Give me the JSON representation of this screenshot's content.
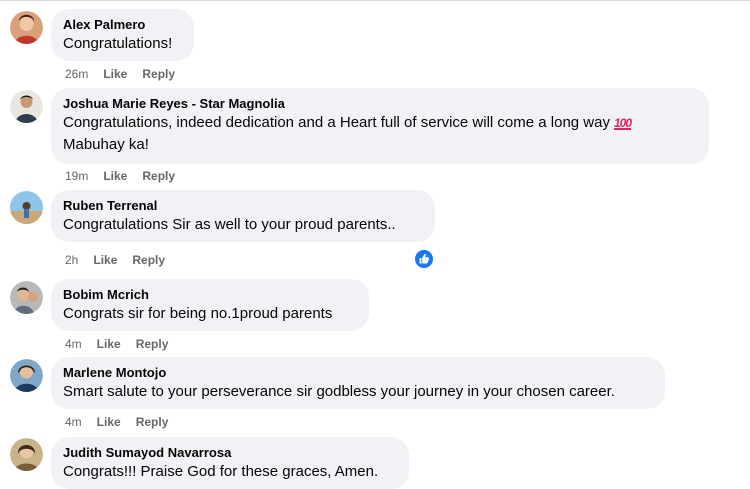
{
  "comments": [
    {
      "author": "Alex Palmero",
      "text_line1": "Congratulations!",
      "text_line2": "",
      "time": "26m",
      "like": "Like",
      "reply": "Reply",
      "avatar_icon": "user-avatar-icon"
    },
    {
      "author": "Joshua Marie Reyes - Star Magnolia",
      "text_line1": "Congratulations, indeed dedication and a Heart full of service will come a long way",
      "emoji": "100",
      "text_line2": "Mabuhay ka!",
      "time": "19m",
      "like": "Like",
      "reply": "Reply",
      "avatar_icon": "user-avatar-icon"
    },
    {
      "author": "Ruben Terrenal",
      "text_line1": "Congratulations Sir as well to your proud parents..",
      "text_line2": "",
      "time": "2h",
      "like": "Like",
      "reply": "Reply",
      "avatar_icon": "user-avatar-icon",
      "reaction_icon": "thumbs-up-icon"
    },
    {
      "author": "Bobim Mcrich",
      "text_line1": "Congrats sir for being no.1proud parents",
      "text_line2": "",
      "time": "4m",
      "like": "Like",
      "reply": "Reply",
      "avatar_icon": "user-avatar-icon"
    },
    {
      "author": "Marlene Montojo",
      "text_line1": "Smart salute to your perseverance sir godbless your journey in your chosen career.",
      "text_line2": "",
      "time": "4m",
      "like": "Like",
      "reply": "Reply",
      "avatar_icon": "user-avatar-icon"
    },
    {
      "author": "Judith Sumayod Navarrosa",
      "text_line1": "Congrats!!! Praise God for these graces, Amen.",
      "text_line2": "",
      "avatar_icon": "user-avatar-icon"
    }
  ],
  "colors": {
    "bubble": "#f0f2f5",
    "meta_text": "#65676b",
    "like_blue": "#1877f2",
    "emoji_red": "#e0245e"
  }
}
